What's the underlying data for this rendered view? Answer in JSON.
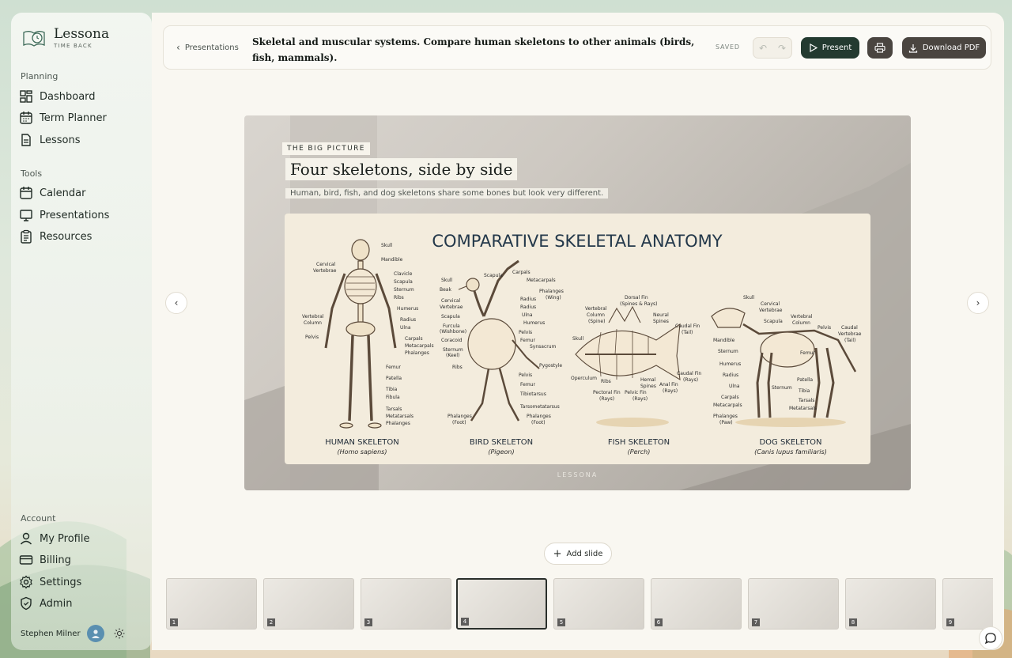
{
  "brand": {
    "name": "Lessona",
    "tagline": "TIME BACK"
  },
  "sidebar": {
    "groups": [
      {
        "title": "Planning",
        "items": [
          {
            "label": "Dashboard",
            "icon": "dashboard-icon"
          },
          {
            "label": "Term Planner",
            "icon": "calendar-grid-icon"
          },
          {
            "label": "Lessons",
            "icon": "document-icon"
          }
        ]
      },
      {
        "title": "Tools",
        "items": [
          {
            "label": "Calendar",
            "icon": "calendar-icon"
          },
          {
            "label": "Presentations",
            "icon": "monitor-icon"
          },
          {
            "label": "Resources",
            "icon": "clipboard-icon"
          }
        ]
      },
      {
        "title": "Account",
        "items": [
          {
            "label": "My Profile",
            "icon": "user-icon"
          },
          {
            "label": "Billing",
            "icon": "credit-card-icon"
          },
          {
            "label": "Settings",
            "icon": "gear-icon"
          },
          {
            "label": "Admin",
            "icon": "shield-icon"
          }
        ]
      }
    ],
    "user": {
      "name": "Stephen Milner"
    }
  },
  "topbar": {
    "back_label": "Presentations",
    "title": "Skeletal and muscular systems. Compare human skeletons to other animals (birds, fish, mammals).",
    "saved_label": "SAVED",
    "present_label": "Present",
    "download_label": "Download PDF"
  },
  "slide": {
    "kicker": "THE BIG PICTURE",
    "title": "Four skeletons, side by side",
    "subtitle": "Human, bird, fish, and dog skeletons share some bones but look very different.",
    "footer": "LESSONA",
    "image": {
      "heading": "COMPARATIVE SKELETAL ANATOMY",
      "panels": [
        {
          "name": "HUMAN SKELETON",
          "species": "(Homo sapiens)"
        },
        {
          "name": "BIRD SKELETON",
          "species": "(Pigeon)"
        },
        {
          "name": "FISH SKELETON",
          "species": "(Perch)"
        },
        {
          "name": "DOG SKELETON",
          "species": "(Canis lupus familiaris)"
        }
      ],
      "human_labels": [
        "Skull",
        "Mandible",
        "Clavicle",
        "Scapula",
        "Sternum",
        "Ribs",
        "Humerus",
        "Radius",
        "Ulna",
        "Carpals",
        "Metacarpals",
        "Phalanges",
        "Femur",
        "Patella",
        "Tibia",
        "Fibula",
        "Tarsals",
        "Metatarsals",
        "Phalanges"
      ],
      "human_left_labels": [
        "Cervical Vertebrae",
        "Vertebral Column",
        "Pelvis"
      ],
      "bird_labels": [
        "Skull",
        "Beak",
        "Cervical Vertebrae",
        "Scapula",
        "Furcula (Wishbone)",
        "Coracoid",
        "Sternum (Keel)",
        "Ribs",
        "Scapula",
        "Carpals",
        "Metacarpals",
        "Phalanges (Wing)",
        "Radius",
        "Ulna",
        "Humerus",
        "Pelvis",
        "Femur",
        "Synsacrum",
        "Pygostyle",
        "Pelvis",
        "Femur",
        "Tibiotarsus",
        "Tarsometatarsus",
        "Phalanges (Foot)",
        "Phalanges (Foot)"
      ],
      "fish_labels": [
        "Dorsal Fin (Spines & Rays)",
        "Vertebral Column (Spine)",
        "Neural Spines",
        "Caudal Fin (Tail)",
        "Skull",
        "Operculum",
        "Ribs",
        "Pectoral Fin (Rays)",
        "Hemal Spines",
        "Pelvic Fin (Rays)",
        "Anal Fin (Rays)",
        "Caudal Fin (Rays)"
      ],
      "dog_labels": [
        "Skull",
        "Cervical Vertebrae",
        "Scapula",
        "Vertebral Column",
        "Pelvis",
        "Caudal Vertebrae (Tail)",
        "Mandible",
        "Sternum",
        "Humerus",
        "Radius",
        "Ulna",
        "Carpals",
        "Metacarpals",
        "Phalanges (Paw)",
        "Femur",
        "Patella",
        "Tibia",
        "Tarsals",
        "Metatarsals",
        "Sternum"
      ]
    }
  },
  "add_slide_label": "Add slide",
  "thumbnails": [
    {
      "num": "1"
    },
    {
      "num": "2"
    },
    {
      "num": "3"
    },
    {
      "num": "4",
      "active": true
    },
    {
      "num": "5"
    },
    {
      "num": "6"
    },
    {
      "num": "7"
    },
    {
      "num": "8"
    },
    {
      "num": "9"
    }
  ]
}
